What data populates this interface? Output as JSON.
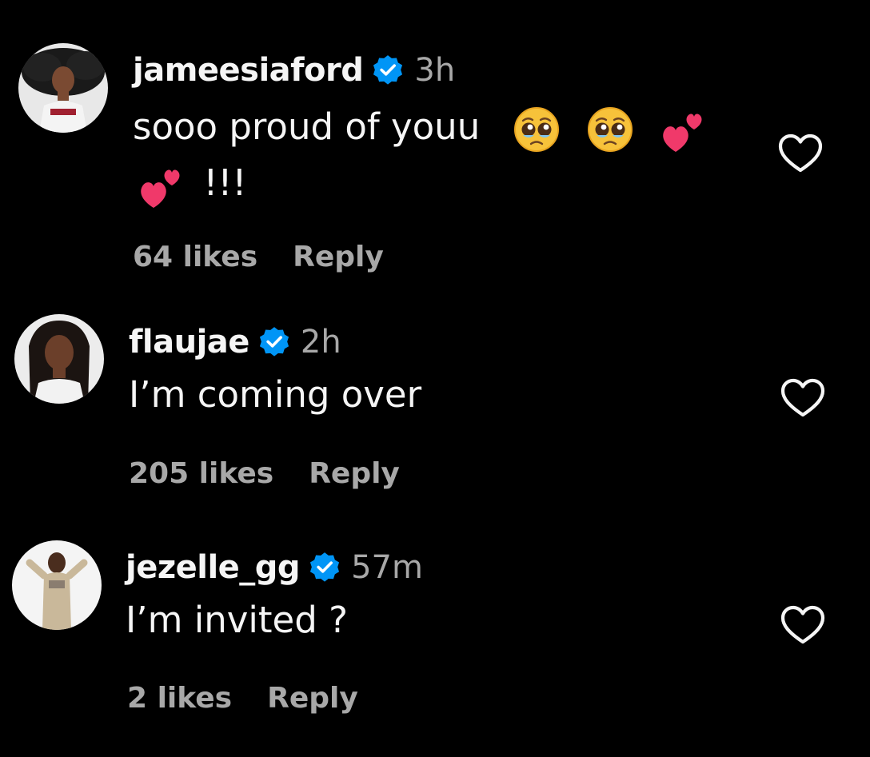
{
  "comments": [
    {
      "username": "jameesiaford",
      "time": "3h",
      "text_line1": "sooo proud of youu",
      "text_line2": "!!!",
      "likes": "64 likes",
      "reply": "Reply",
      "icons": [
        "verified-badge",
        "pleading-face-emoji",
        "pleading-face-emoji",
        "two-hearts-emoji",
        "two-hearts-emoji",
        "heart-outline"
      ]
    },
    {
      "username": "flaujae",
      "time": "2h",
      "text": "I’m coming over",
      "likes": "205 likes",
      "reply": "Reply",
      "icons": [
        "verified-badge",
        "heart-outline"
      ]
    },
    {
      "username": "jezelle_gg",
      "time": "57m",
      "text": "I’m invited ?",
      "likes": "2 likes",
      "reply": "Reply",
      "icons": [
        "verified-badge",
        "heart-outline"
      ]
    }
  ],
  "colors": {
    "background": "#000000",
    "primary_text": "#f5f5f5",
    "secondary_text": "#a8a8a8",
    "verified": "#0095f6",
    "heart": "#f5f5f5"
  }
}
